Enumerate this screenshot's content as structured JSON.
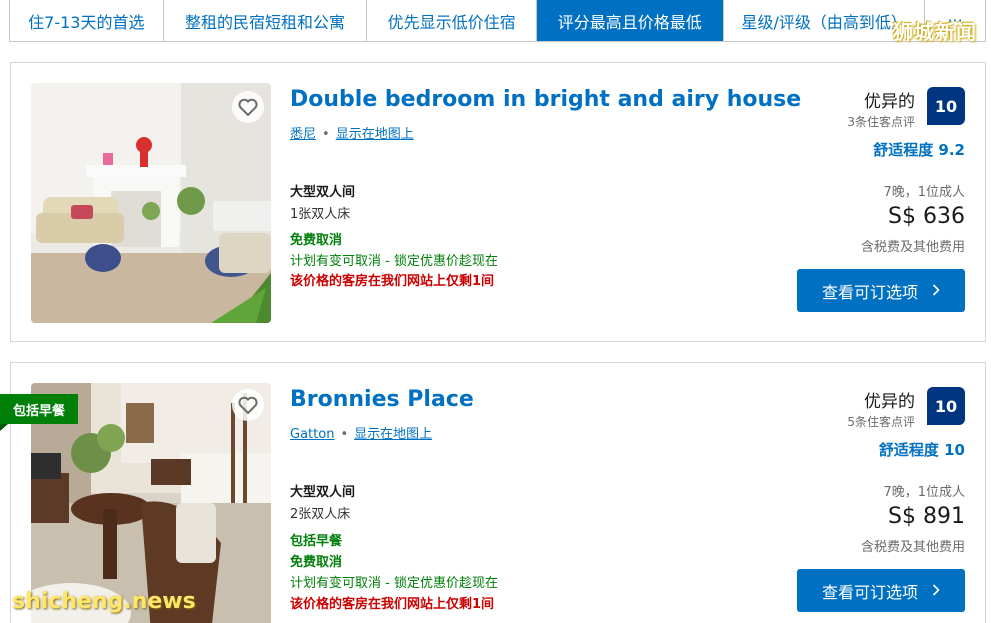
{
  "sort_tabs": [
    {
      "label": "住7-13天的首选",
      "active": false
    },
    {
      "label": "整租的民宿短租和公寓",
      "active": false
    },
    {
      "label": "优先显示低价住宿",
      "active": false
    },
    {
      "label": "评分最高且价格最低",
      "active": true
    },
    {
      "label": "星级/评级（由高到低）",
      "active": false
    },
    {
      "label": "···",
      "active": false
    }
  ],
  "watermarks": {
    "top": "狮城新闻",
    "bottom": "shicheng.news"
  },
  "listings": [
    {
      "title": "Double bedroom in bright and airy house",
      "city": "悉尼",
      "map_link": "显示在地图上",
      "room_name": "大型双人间",
      "bed": "1张双人床",
      "breakfast": "",
      "free_cancel": "免费取消",
      "cancel_note": "计划有变可取消 - 锁定优惠价趁现在",
      "scarcity": "该价格的客房在我们网站上仅剩1间",
      "rating_word": "优异的",
      "reviews": "3条住客点评",
      "score": "10",
      "comfort": "舒适程度 9.2",
      "stay": "7晚，1位成人",
      "price": "S$ 636",
      "tax": "含税费及其他费用",
      "cta": "查看可订选项",
      "cta_icon": "chevron-right-icon"
    },
    {
      "title": "Bronnies Place",
      "city": "Gatton",
      "map_link": "显示在地图上",
      "room_name": "大型双人间",
      "bed": "2张双人床",
      "breakfast": "包括早餐",
      "free_cancel": "免费取消",
      "cancel_note": "计划有变可取消 - 锁定优惠价趁现在",
      "scarcity": "该价格的客房在我们网站上仅剩1间",
      "rating_word": "优异的",
      "reviews": "5条住客点评",
      "score": "10",
      "comfort": "舒适程度 10",
      "stay": "7晚，1位成人",
      "price": "S$ 891",
      "tax": "含税费及其他费用",
      "cta": "查看可订选项",
      "cta_icon": "chevron-right-icon",
      "badge": "包括早餐"
    }
  ],
  "colors": {
    "brand_blue": "#0071c2",
    "score_navy": "#003580",
    "green": "#008009",
    "red": "#cc0000"
  }
}
